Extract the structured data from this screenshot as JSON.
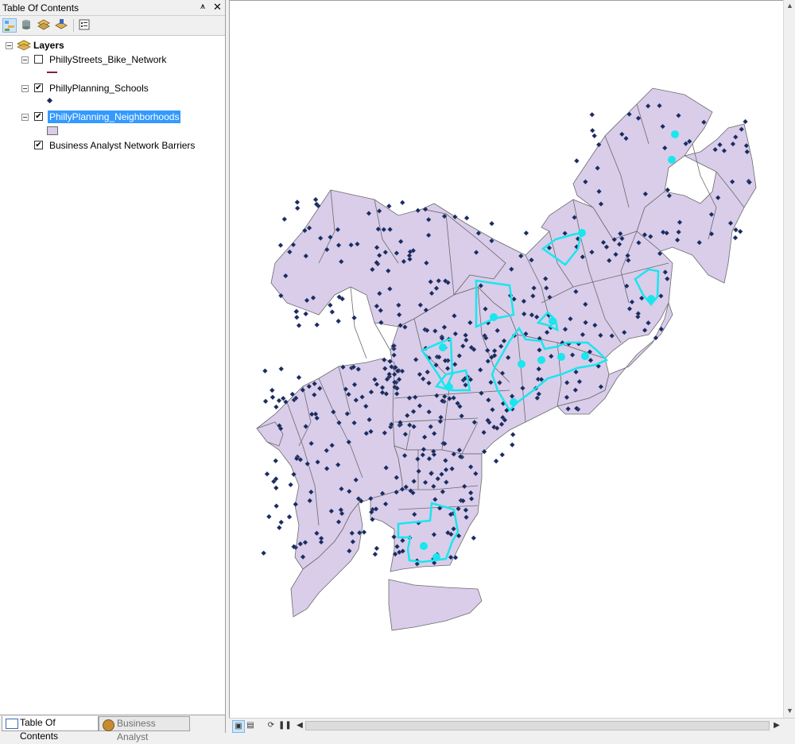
{
  "toc": {
    "title": "Table Of Contents",
    "pin_glyph": "⩚",
    "close_glyph": "✕",
    "toolbar": [
      "list-by-drawing-order-icon",
      "list-by-source-icon",
      "list-by-visibility-icon",
      "list-by-selection-icon",
      "options-icon"
    ],
    "root_label": "Layers",
    "layers": [
      {
        "label": "PhillyStreets_Bike_Network",
        "checked": false,
        "legend": "line",
        "legend_color": "#8b1a4a"
      },
      {
        "label": "PhillyPlanning_Schools",
        "checked": true,
        "legend": "point",
        "legend_color": "#1c2a5a"
      },
      {
        "label": "PhillyPlanning_Neighborhoods",
        "checked": true,
        "legend": "polygon",
        "legend_color": "#d9cdea",
        "selected": true
      },
      {
        "label": "Business Analyst Network Barriers",
        "checked": true,
        "legend": "none"
      }
    ],
    "check_glyph": "✔",
    "tabs": {
      "active": "Table Of Contents",
      "inactive": "Business Analyst"
    }
  },
  "map": {
    "fill_color": "#d9cdea",
    "outline_color": "#6b6b6b",
    "school_color": "#1c2a5a",
    "barrier_color": "#19e6ee"
  },
  "statusbar": {
    "layout_view_icon": "layout-view-icon",
    "data_view_icon": "data-view-icon",
    "refresh_icon": "refresh-icon",
    "pause_icon": "pause-icon"
  }
}
